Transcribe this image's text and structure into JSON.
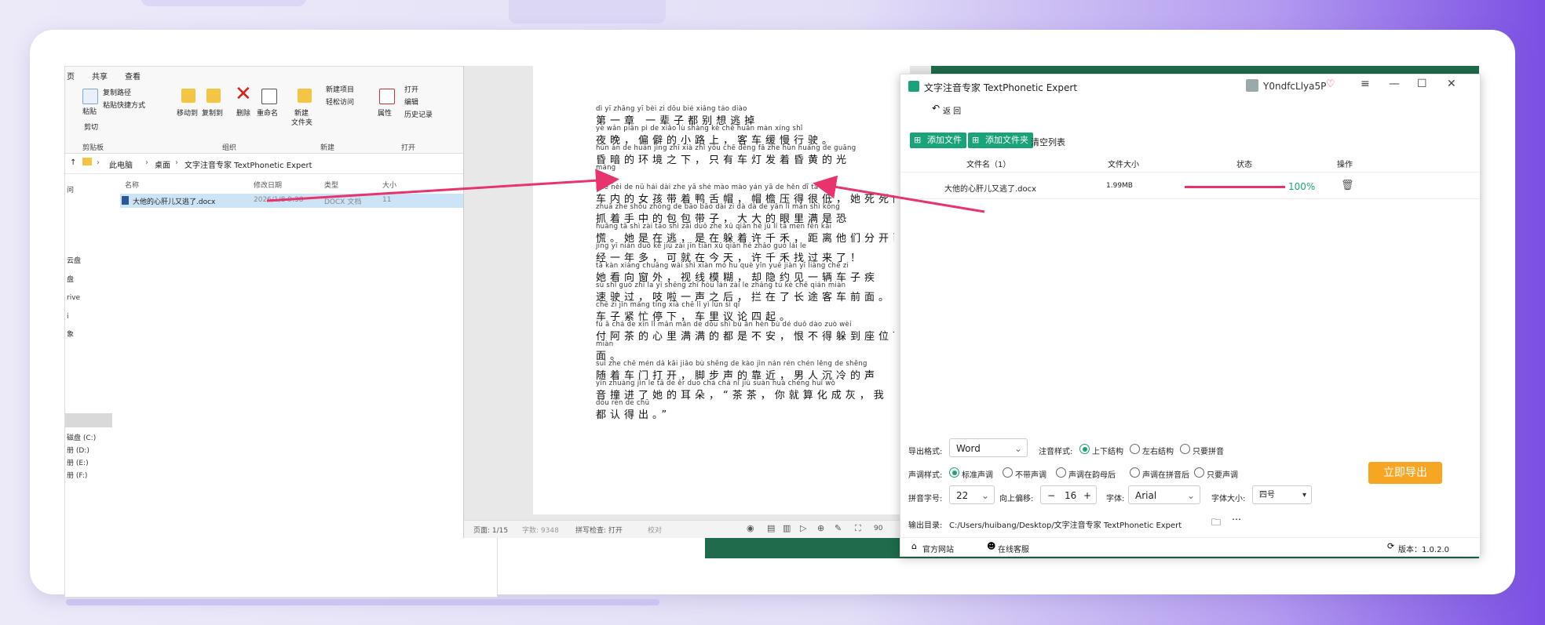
{
  "explorer": {
    "tabs": [
      "页",
      "共享",
      "查看"
    ],
    "ribbon": {
      "copy_path": "复制路径",
      "paste_shortcut": "粘贴快捷方式",
      "cut": "剪切",
      "paste": "粘贴",
      "group_clipboard": "剪贴板",
      "move_to": "移动到",
      "copy_to": "复制到",
      "delete": "删除",
      "rename": "重命名",
      "group_organize": "组织",
      "new_item": "新建项目",
      "easy_access": "轻松访问",
      "new_folder_line1": "新建",
      "new_folder_line2": "文件夹",
      "group_new": "新建",
      "properties": "属性",
      "open": "打开",
      "edit": "编辑",
      "history": "历史记录",
      "group_open": "打开"
    },
    "breadcrumb": [
      "此电脑",
      "桌面",
      "文字注音专家 TextPhonetic Expert"
    ],
    "columns": [
      "名称",
      "修改日期",
      "类型",
      "大小"
    ],
    "file": {
      "name": "大他的心肝儿又逃了.docx",
      "date": "2026/1/8 9:38",
      "type": "DOCX 文档",
      "size": "11"
    },
    "sidebar": [
      "问",
      "云盘",
      "盘",
      "rive",
      "i",
      "象",
      "磁盘 (C:)",
      "册 (D:)",
      "册 (E:)",
      "册 (F:)"
    ]
  },
  "word": {
    "lines": [
      {
        "py": "dì  yī  zhāng    yī  bèi  zi   dōu bié xiǎng táo diào",
        "hz": "第一章  一辈子都别想逃掉"
      },
      {
        "py": "yè  wǎn     piān  pì  de xiǎo  lù  shàng      kè  chē huǎn màn xíng shǐ",
        "hz": "夜晚，偏僻的小路上，客车缓慢行驶。"
      },
      {
        "py": "hūn àn de huán jìng zhī xià     zhǐ yǒu chē dēng fā zhe hūn huáng de guāng",
        "hz": "昏暗的环境之下，只有车灯发着昏黄的光"
      },
      {
        "py": "máng",
        "hz": "芒。"
      },
      {
        "py": "chē nèi de nǚ hái dài zhe yā shé mào    mào yán yā de hěn dī     tā  sǐ  sǐ",
        "hz": "车内的女孩带着鸭舌帽，帽檐压得很低，她死死的"
      },
      {
        "py": "zhuā zhe shǒu zhōng de bāo bāo dài zi     dà dà de yǎn  lǐ  mǎn shì kǒng",
        "hz": "抓着手中的包包带子，大大的眼里满是恐"
      },
      {
        "py": "huāng     tā shì zài táo     shì zài duǒ zhe xǔ qiān hé     jù  lí  tā men fēn kāi",
        "hz": "慌。她是在逃，是在躲着许千禾，距离他们分开已"
      },
      {
        "py": "jīng yī nián duō     kě jiù zài jīn tiān     xǔ qiān hé zhǎo guò lái le",
        "hz": "经一年多，可就在今天，许千禾找过来了！"
      },
      {
        "py": "tā kàn xiàng chuāng wài      shì xiàn mó hu      què yǐn yuē jiàn yī liàng chē zi",
        "hz": "她看向窗外，视线模糊，却隐约见一辆车子疾"
      },
      {
        "py": "sù shǐ guò      zhī  la  yī shēng zhī hòu     lán zài le zhǎng tú kè chē qián miàn",
        "hz": "速驶过，吱啦一声之后，拦在了长途客车前面。"
      },
      {
        "py": "chē zi jǐn máng tíng xià     chē  lǐ  yì lùn sì qǐ",
        "hz": "车子紧忙停下，车里议论四起。"
      },
      {
        "py": "fù  ā  chá de xīn  lǐ  mǎn mǎn de dōu shì bù ān     hèn bù dé duǒ dào zuò wèi",
        "hz": "付阿茶的心里满满的都是不安，恨不得躲到座位下"
      },
      {
        "py": "miàn",
        "hz": "面。"
      },
      {
        "py": "suí zhe chē mén dǎ kāi     jiǎo bù shēng de kào jìn     nán rén chén lěng de shēng",
        "hz": "随着车门打开，脚步声的靠近，男人沉冷的声"
      },
      {
        "py": "yīn zhuàng jìn le  tā de ěr duo      chá chá     nǐ jiù suàn huà chéng huī     wǒ",
        "hz": "音撞进了她的耳朵，“茶茶，你就算化成灰，我"
      },
      {
        "py": "dōu rèn de chū",
        "hz": "都认得出。”"
      }
    ],
    "status": {
      "page": "页面: 1/15",
      "words": "字数: 9348",
      "spell": "拼写检查: 打开",
      "proof": "校对",
      "zoom": "90"
    }
  },
  "app": {
    "title": "文字注音专家 TextPhonetic Expert",
    "user": "Y0ndfcLlya5P",
    "back": "返 回",
    "add_file": "添加文件",
    "add_folder": "添加文件夹",
    "clear_list": "清空列表",
    "columns": [
      "文件名（1）",
      "文件大小",
      "状态",
      "操作"
    ],
    "file_row": {
      "name": "大他的心肝儿又逃了.docx",
      "size": "1.99MB",
      "progress": 100,
      "progress_text": "100%"
    },
    "export_format_label": "导出格式:",
    "export_format": "Word",
    "phonetic_style_label": "注音样式:",
    "phonetic_options": [
      "上下结构",
      "左右结构",
      "只要拼音"
    ],
    "tone_style_label": "声调样式:",
    "tone_options": [
      "标准声调",
      "不带声调",
      "声调在韵母后",
      "声调在拼音后",
      "只要声调"
    ],
    "pinyin_size_label": "拼音字号:",
    "pinyin_size": "22",
    "offset_label": "向上偏移:",
    "offset_value": "16",
    "font_label": "字体:",
    "font_value": "Arial",
    "font_size_label": "字体大小:",
    "font_size_value": "四号",
    "export_button": "立即导出",
    "output_dir_label": "输出目录:",
    "output_dir": "C:/Users/huibang/Desktop/文字注音专家 TextPhonetic Expert",
    "website": "官方网站",
    "support": "在线客服",
    "version": "版本：1.0.2.0"
  },
  "colors": {
    "accent": "#1aa37a",
    "export": "#f6a623",
    "progress": "#e8336d",
    "arrow": "#e8336d"
  }
}
